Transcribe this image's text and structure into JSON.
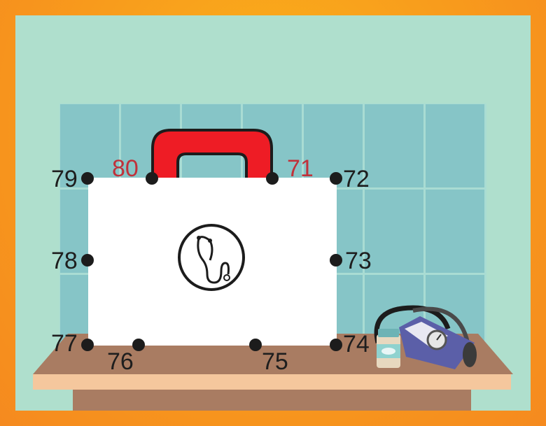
{
  "puzzle": {
    "type": "connect-the-dots",
    "labels": {
      "n71": "71",
      "n72": "72",
      "n73": "73",
      "n74": "74",
      "n75": "75",
      "n76": "76",
      "n77": "77",
      "n78": "78",
      "n79": "79",
      "n80": "80"
    },
    "highlight_color": "#c0313a",
    "dot_color": "#1c1c1c"
  },
  "scene": {
    "case_icon": "stethoscope-icon",
    "handle_color": "#ee1c25",
    "props": [
      "medicine-bottle",
      "blood-pressure-monitor"
    ]
  }
}
